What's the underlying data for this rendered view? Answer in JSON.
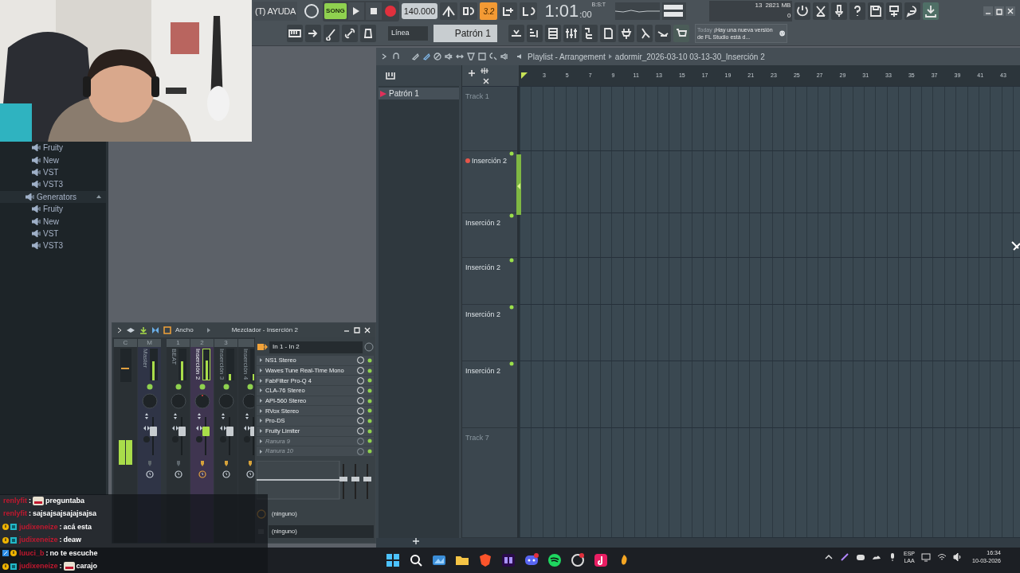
{
  "toolbar": {
    "menu": "(T) AYUDA",
    "mode": "SONG",
    "mode_selected": true,
    "tempo": "140.000",
    "time": "1:01",
    "time_ticks": ":00",
    "time_label": "B:S:T",
    "snap_button": "3.2",
    "cpu": "13",
    "memory": "2821 MB",
    "polyphony": "0",
    "snap": "Línea",
    "pattern": "Patrón 1",
    "hint_label": "Today",
    "hint": "¡Hay una nueva versión de FL Studio está d..."
  },
  "browser": {
    "items": [
      {
        "label": "Fruity"
      },
      {
        "label": "New"
      },
      {
        "label": "VST"
      },
      {
        "label": "VST3"
      },
      {
        "label": "Generators",
        "expanded": true,
        "children": [
          {
            "label": "Fruity"
          },
          {
            "label": "New"
          },
          {
            "label": "VST"
          },
          {
            "label": "VST3"
          }
        ]
      }
    ]
  },
  "playlist": {
    "title": "Playlist - Arrangement",
    "file": "adormir_2026-03-10 03-13-30_Inserción 2",
    "patterns": [
      {
        "label": "Patrón 1",
        "selected": true
      }
    ],
    "ruler": [
      "3",
      "5",
      "7",
      "9",
      "11",
      "13",
      "15",
      "17",
      "19",
      "21",
      "23",
      "25",
      "27",
      "29",
      "31",
      "33",
      "35",
      "37",
      "39",
      "41",
      "43"
    ],
    "tracks": [
      {
        "label": "Track 1",
        "kind": "empty"
      },
      {
        "label": "Inserción 2",
        "kind": "audio",
        "selected": true
      },
      {
        "label": "Inserción 2",
        "kind": "audio",
        "selected": false
      },
      {
        "label": "Inserción 2",
        "kind": "audio",
        "selected": false
      },
      {
        "label": "Inserción 2",
        "kind": "audio",
        "selected": false
      },
      {
        "label": "Inserción 2",
        "kind": "audio",
        "selected": false
      },
      {
        "label": "Track 7",
        "kind": "empty"
      }
    ]
  },
  "mixer": {
    "toolbar_label": "Ancho",
    "title": "Mezclador - Inserción 2",
    "strips": [
      {
        "number": "C",
        "kind": "current",
        "selected": false,
        "level": 0.55
      },
      {
        "number": "M",
        "label": "Master",
        "kind": "master",
        "selected": false,
        "level": 0.6
      },
      {
        "number": "1",
        "label": "BEAT",
        "kind": "insert",
        "selected": false,
        "level": 0.6
      },
      {
        "number": "2",
        "label": "Inserción 2",
        "kind": "insert",
        "selected": true,
        "level": 0.62
      },
      {
        "number": "3",
        "label": "Inserción 3",
        "kind": "insert",
        "selected": false,
        "level": 0.2
      },
      {
        "label": "Inserción 4",
        "kind": "insert",
        "selected": false,
        "level": 0.2
      }
    ],
    "input": "In 1 - In 2",
    "slots": [
      {
        "label": "NS1 Stereo",
        "empty": false
      },
      {
        "label": "Waves Tune Real-Time Mono",
        "empty": false
      },
      {
        "label": "FabFilter Pro-Q 4",
        "empty": false
      },
      {
        "label": "CLA-76 Stereo",
        "empty": false
      },
      {
        "label": "API-560 Stereo",
        "empty": false
      },
      {
        "label": "RVox Stereo",
        "empty": false
      },
      {
        "label": "Pro-DS",
        "empty": false
      },
      {
        "label": "Fruity Limiter",
        "empty": false
      },
      {
        "label": "Ranura 9",
        "empty": true
      },
      {
        "label": "Ranura 10",
        "empty": true
      }
    ],
    "outputs": [
      "(ninguno)",
      "(ninguno)"
    ]
  },
  "chat": [
    {
      "kind": "viewer",
      "user": "renlyfit",
      "separator": ":",
      "emote": true,
      "text": "preguntaba"
    },
    {
      "kind": "viewer",
      "user": "renlyfit",
      "separator": ":",
      "emote": false,
      "text": "sajsajsajsajajsajsa"
    },
    {
      "kind": "subscriber",
      "user": "judixeneize",
      "separator": ":",
      "emote": false,
      "text": "acá esta"
    },
    {
      "kind": "subscriber",
      "user": "judixeneize",
      "separator": ":",
      "emote": false,
      "text": "deaw"
    },
    {
      "kind": "prime",
      "user": "luuci_b",
      "separator": ":",
      "emote": false,
      "text": "no te escuche"
    },
    {
      "kind": "subscriber",
      "user": "judixeneize",
      "separator": ":",
      "emote": true,
      "text": "carajo"
    }
  ],
  "taskbar": {
    "language": "ESP",
    "layout": "LAA",
    "time": "16:34",
    "date": "10-03-2026"
  }
}
